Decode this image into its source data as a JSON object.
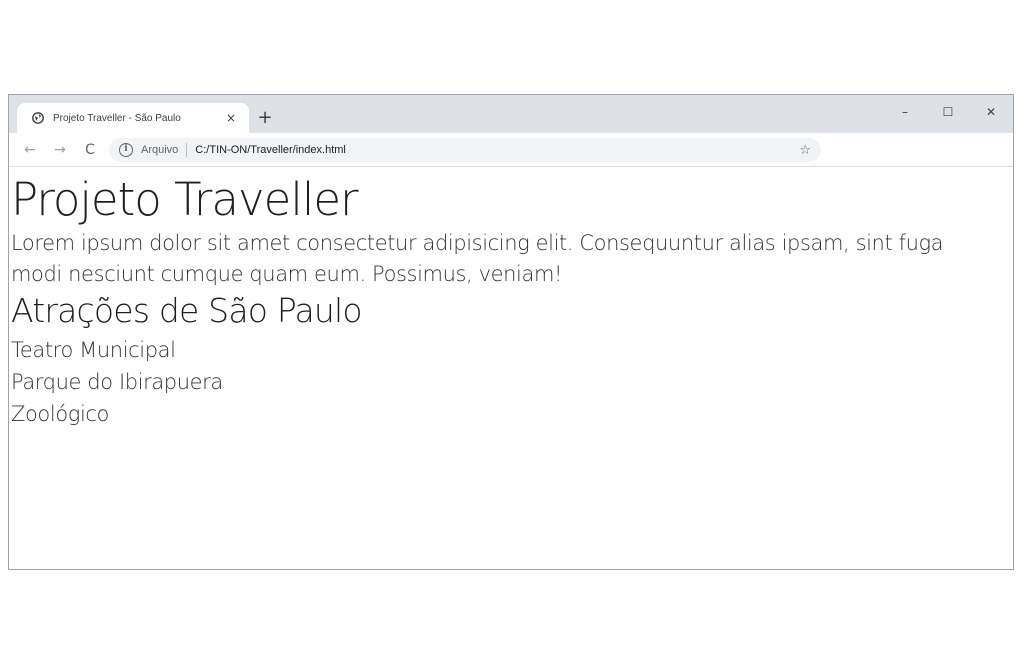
{
  "tab": {
    "title": "Projeto Traveller - São Paulo",
    "close": "×"
  },
  "new_tab": "+",
  "window_controls": {
    "minimize": "–",
    "maximize": "☐",
    "close": "✕"
  },
  "toolbar": {
    "back": "←",
    "forward": "→",
    "reload": "C",
    "security_label": "Arquivo",
    "url": "C:/TIN-ON/Traveller/index.html",
    "bookmark": "☆"
  },
  "page": {
    "title": "Projeto Traveller",
    "intro": "Lorem ipsum dolor sit amet consectetur adipisicing elit. Consequuntur alias ipsam, sint fuga modi nesciunt cumque quam eum. Possimus, veniam!",
    "section_title": "Atrações de São Paulo",
    "attractions": [
      "Teatro Municipal",
      "Parque do Ibirapuera",
      "Zoológico"
    ]
  }
}
